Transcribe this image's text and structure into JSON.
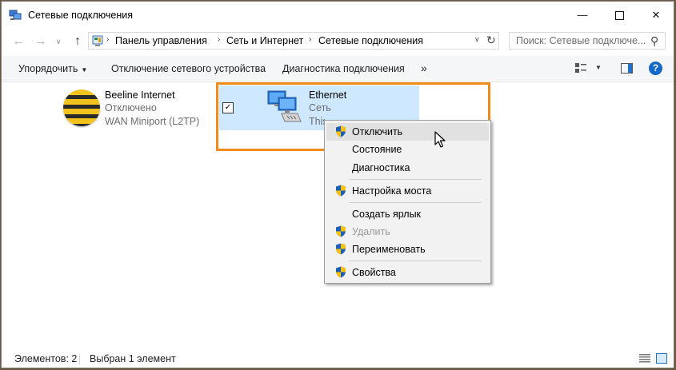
{
  "window": {
    "title": "Сетевые подключения",
    "controls": {
      "minimize": "—",
      "close": "✕"
    }
  },
  "nav": {
    "back": "←",
    "forward": "→",
    "recent": "∨",
    "up": "↑",
    "breadcrumbs": [
      "Панель управления",
      "Сеть и Интернет",
      "Сетевые подключения"
    ],
    "separator": "›",
    "dropdown": "∨",
    "refresh": "↻",
    "search_placeholder": "Поиск: Сетевые подключе...",
    "search_icon": "⚲"
  },
  "toolbar": {
    "organize": "Упорядочить",
    "disable_device": "Отключение сетевого устройства",
    "diagnose": "Диагностика подключения",
    "more": "»",
    "help": "?"
  },
  "connections": [
    {
      "name": "Beeline Internet",
      "status": "Отключено",
      "device": "WAN Miniport (L2TP)",
      "icon": "beeline-logo-icon"
    },
    {
      "name": "Ethernet",
      "status": "Сеть",
      "device": "This Qualcomm Ath",
      "icon": "network-computers-icon",
      "checkbox": "✓"
    }
  ],
  "context_menu": {
    "items": [
      {
        "label": "Отключить",
        "shield": true,
        "hover": true
      },
      {
        "label": "Состояние",
        "shield": false
      },
      {
        "label": "Диагностика",
        "shield": false
      },
      {
        "label": "Настройка моста",
        "shield": true
      },
      {
        "label": "Создать ярлык",
        "shield": false
      },
      {
        "label": "Удалить",
        "shield": true,
        "disabled": true
      },
      {
        "label": "Переименовать",
        "shield": true
      },
      {
        "label": "Свойства",
        "shield": true
      }
    ]
  },
  "statusbar": {
    "items_count": "Элементов: 2",
    "selected": "Выбран 1 элемент"
  },
  "colors": {
    "selection": "#cde8ff",
    "highlight_frame": "#f18b1b",
    "accent": "#1468c6"
  }
}
